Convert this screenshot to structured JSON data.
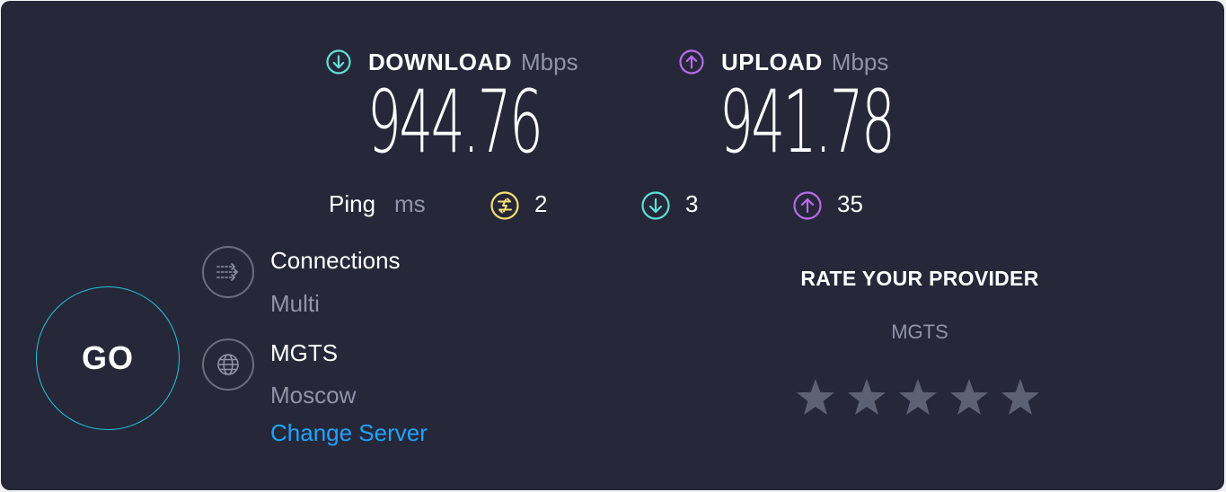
{
  "download": {
    "title": "DOWNLOAD",
    "unit": "Mbps",
    "value": "944.76",
    "icon": "download-arrow-icon",
    "color": "#5fe0d6"
  },
  "upload": {
    "title": "UPLOAD",
    "unit": "Mbps",
    "value": "941.78",
    "icon": "upload-arrow-icon",
    "color": "#b86be8"
  },
  "ping": {
    "label": "Ping",
    "unit": "ms",
    "idle": {
      "value": "2",
      "icon": "idle-ping-icon",
      "color": "#f5e171"
    },
    "download": {
      "value": "3",
      "icon": "download-ping-icon",
      "color": "#5fe0d6"
    },
    "upload": {
      "value": "35",
      "icon": "upload-ping-icon",
      "color": "#b86be8"
    }
  },
  "go_button": {
    "label": "GO",
    "color": "#1fc6dd"
  },
  "connections": {
    "title": "Connections",
    "value": "Multi",
    "icon": "connections-icon"
  },
  "server": {
    "provider": "MGTS",
    "location": "Moscow",
    "change_label": "Change Server",
    "icon": "globe-icon",
    "link_color": "#1fa3ff"
  },
  "rating": {
    "title": "RATE YOUR PROVIDER",
    "provider": "MGTS",
    "stars": 5,
    "star_color": "#5e6073"
  }
}
